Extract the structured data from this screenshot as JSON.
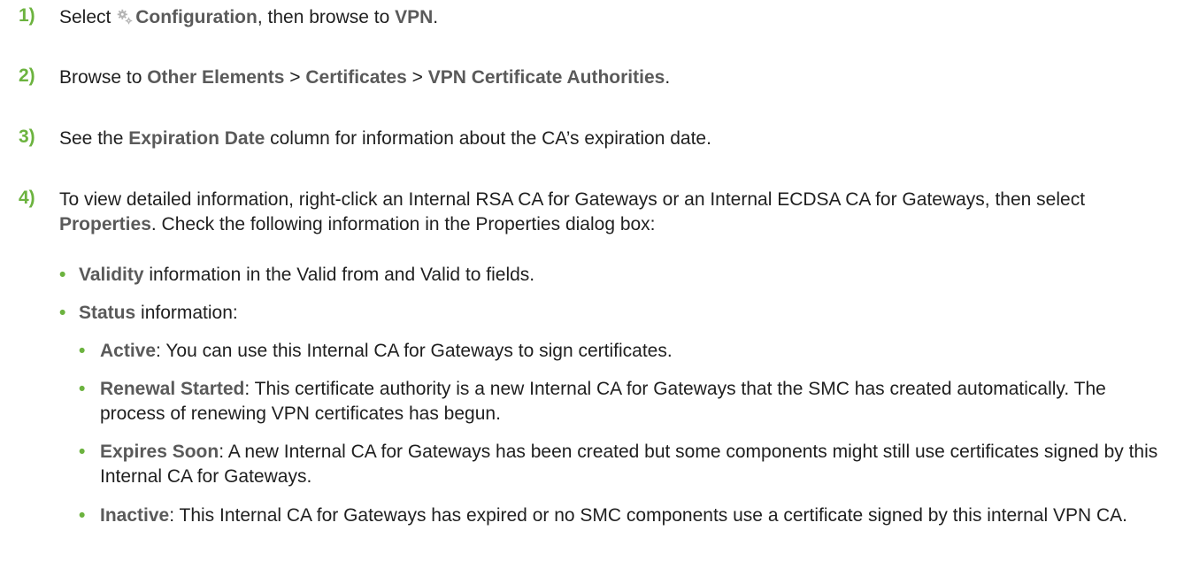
{
  "colors": {
    "accent": "#6cb33f",
    "ui_term": "#5a5a5a",
    "text": "#1f1f1f"
  },
  "steps": [
    {
      "num": "1)",
      "t1": "Select ",
      "icon": "gear-icon",
      "ui1": "Configuration",
      "t2": ", then browse to ",
      "ui2": "VPN",
      "t3": "."
    },
    {
      "num": "2)",
      "t1": "Browse to ",
      "ui1": "Other Elements",
      "t2": " > ",
      "ui2": "Certificates",
      "t3": " > ",
      "ui3": "VPN Certificate Authorities",
      "t4": "."
    },
    {
      "num": "3)",
      "t1": "See the ",
      "ui1": "Expiration Date",
      "t2": " column for information about the CA’s expiration date."
    },
    {
      "num": "4)",
      "t1": "To view detailed information, right-click an Internal RSA CA for Gateways or an Internal ECDSA CA for Gateways, then select ",
      "ui1": "Properties",
      "t2": ". Check the following information in the Properties dialog box:"
    }
  ],
  "bullet_char": "•",
  "bullets": [
    {
      "term": "Validity",
      "text": " information in the Valid from and Valid to fields."
    },
    {
      "term": "Status",
      "text": " information:"
    }
  ],
  "status_items": [
    {
      "term": "Active",
      "text": ": You can use this Internal CA for Gateways to sign certificates."
    },
    {
      "term": "Renewal Started",
      "text": ": This certificate authority is a new Internal CA for Gateways that the SMC has created automatically. The process of renewing VPN certificates has begun."
    },
    {
      "term": "Expires Soon",
      "text": ": A new Internal CA for Gateways has been created but some components might still use certificates signed by this Internal CA for Gateways."
    },
    {
      "term": "Inactive",
      "text": ": This Internal CA for Gateways has expired or no SMC components use a certificate signed by this internal VPN CA."
    }
  ]
}
